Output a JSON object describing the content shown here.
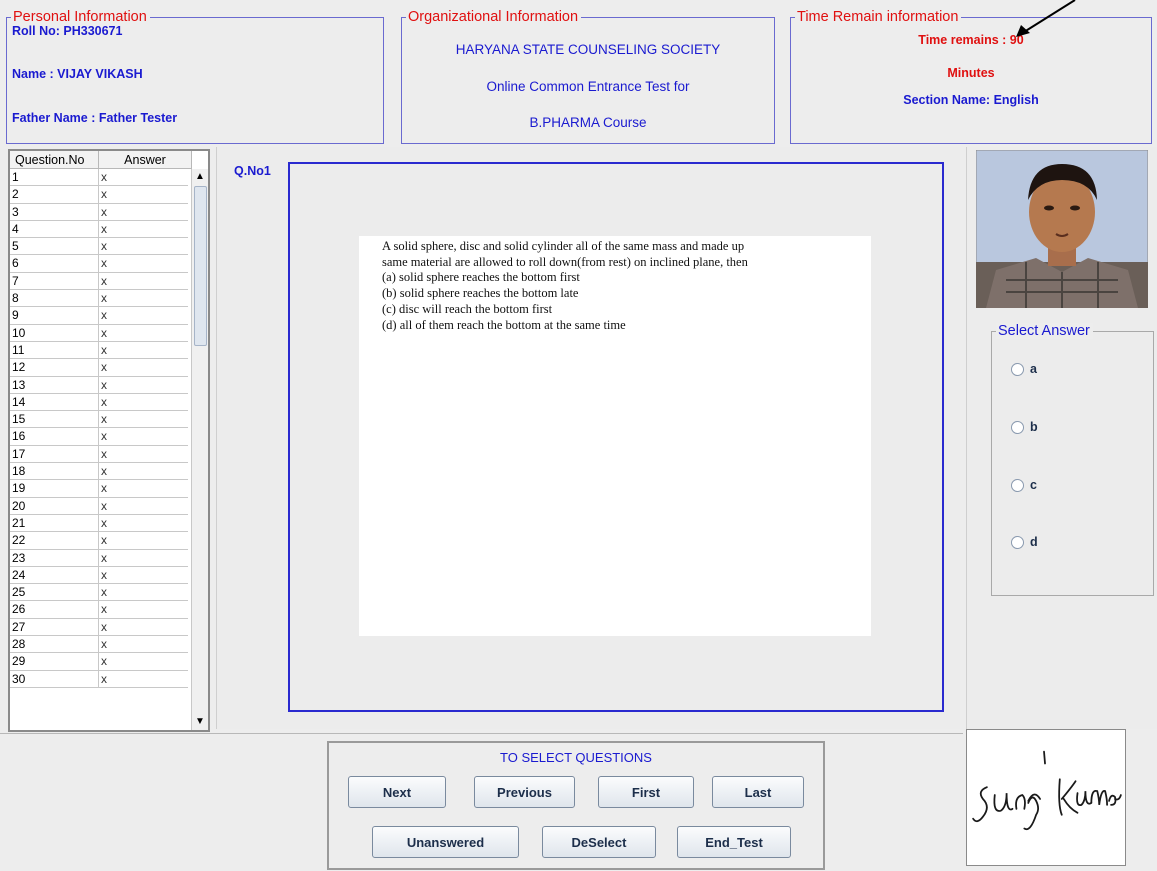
{
  "personal": {
    "legend": "Personal Information",
    "roll_no": "Roll No: PH330671",
    "name": "Name : VIJAY VIKASH",
    "father_name": "Father Name : Father Tester"
  },
  "organization": {
    "legend": "Organizational Information",
    "line1": "HARYANA STATE COUNSELING SOCIETY",
    "line2": "Online Common Entrance Test for",
    "line3": "B.PHARMA  Course"
  },
  "time": {
    "legend": "Time Remain information",
    "remains": "Time remains : 90",
    "unit": "Minutes",
    "section": "Section Name: English"
  },
  "question_table": {
    "columns": [
      "Question.No",
      "Answer"
    ],
    "rows": [
      {
        "no": "1",
        "ans": "x"
      },
      {
        "no": "2",
        "ans": "x"
      },
      {
        "no": "3",
        "ans": "x"
      },
      {
        "no": "4",
        "ans": "x"
      },
      {
        "no": "5",
        "ans": "x"
      },
      {
        "no": "6",
        "ans": "x"
      },
      {
        "no": "7",
        "ans": "x"
      },
      {
        "no": "8",
        "ans": "x"
      },
      {
        "no": "9",
        "ans": "x"
      },
      {
        "no": "10",
        "ans": "x"
      },
      {
        "no": "11",
        "ans": "x"
      },
      {
        "no": "12",
        "ans": "x"
      },
      {
        "no": "13",
        "ans": "x"
      },
      {
        "no": "14",
        "ans": "x"
      },
      {
        "no": "15",
        "ans": "x"
      },
      {
        "no": "16",
        "ans": "x"
      },
      {
        "no": "17",
        "ans": "x"
      },
      {
        "no": "18",
        "ans": "x"
      },
      {
        "no": "19",
        "ans": "x"
      },
      {
        "no": "20",
        "ans": "x"
      },
      {
        "no": "21",
        "ans": "x"
      },
      {
        "no": "22",
        "ans": "x"
      },
      {
        "no": "23",
        "ans": "x"
      },
      {
        "no": "24",
        "ans": "x"
      },
      {
        "no": "25",
        "ans": "x"
      },
      {
        "no": "26",
        "ans": "x"
      },
      {
        "no": "27",
        "ans": "x"
      },
      {
        "no": "28",
        "ans": "x"
      },
      {
        "no": "29",
        "ans": "x"
      },
      {
        "no": "30",
        "ans": "x"
      }
    ]
  },
  "question": {
    "label": "Q.No1",
    "text": [
      "A solid sphere, disc and solid cylinder all of the same mass and made up",
      "same material are allowed to roll down(from rest) on inclined plane, then",
      "(a) solid sphere reaches the bottom first",
      "(b) solid sphere reaches the bottom late",
      "(c) disc will reach the bottom first",
      "(d) all of them reach the bottom at the same time"
    ]
  },
  "answer": {
    "legend": "Select Answer",
    "options": [
      "a",
      "b",
      "c",
      "d"
    ]
  },
  "navigation": {
    "title": "TO SELECT QUESTIONS",
    "next": "Next",
    "previous": "Previous",
    "first": "First",
    "last": "Last",
    "unanswered": "Unanswered",
    "deselect": "DeSelect",
    "end_test": "End_Test"
  },
  "icons": {
    "scroll_up": "scroll-up-arrow-icon",
    "scroll_down": "scroll-down-arrow-icon",
    "annotation": "annotation-arrow-icon"
  },
  "colors": {
    "legend_red": "#e01010",
    "label_blue": "#1a1ad0",
    "panel_border": "#6a6ad0",
    "question_frame": "#2a2acf"
  }
}
